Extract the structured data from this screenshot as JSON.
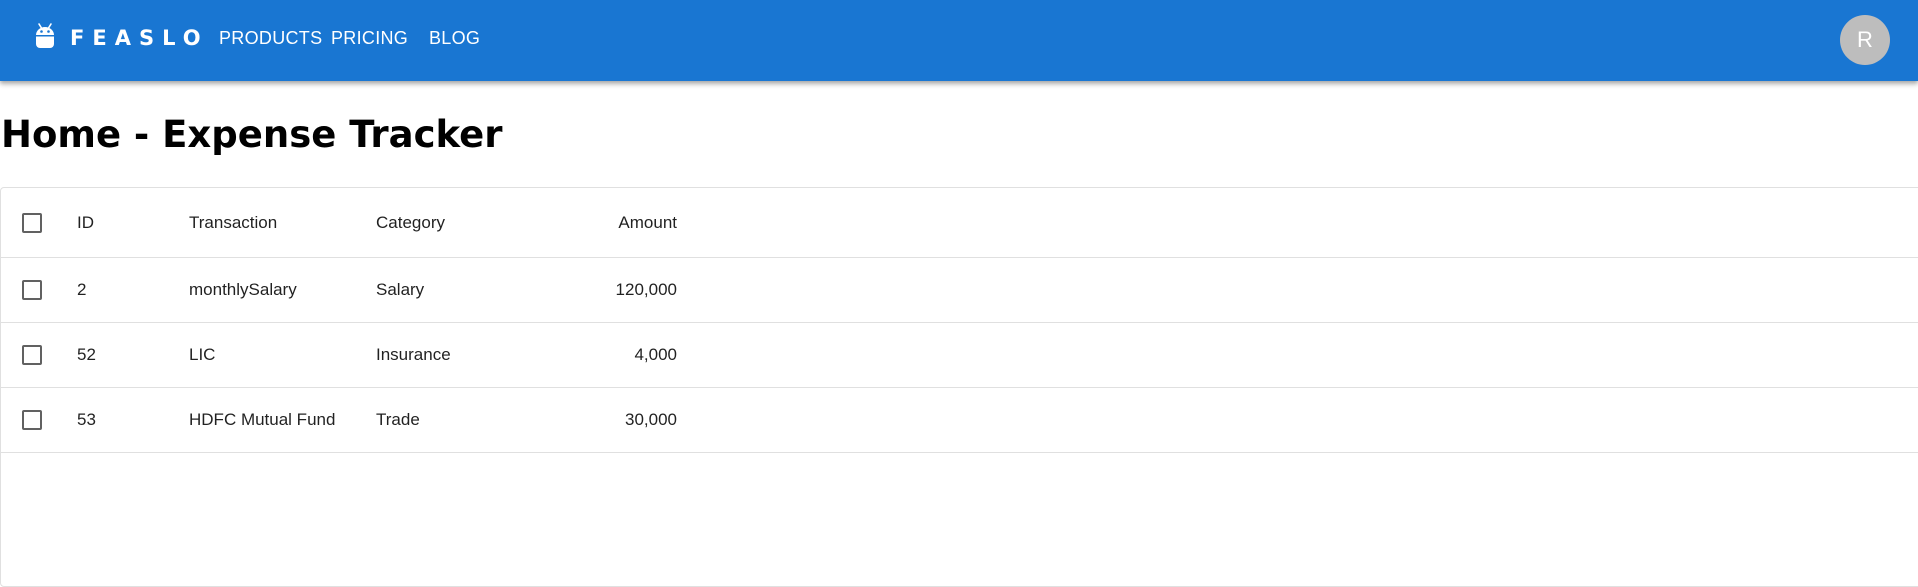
{
  "appbar": {
    "brand": "FEASLO",
    "nav": [
      "PRODUCTS",
      "PRICING",
      "BLOG"
    ],
    "avatar_letter": "R",
    "color": "#1976d2"
  },
  "page": {
    "title": "Home - Expense Tracker"
  },
  "table": {
    "columns": [
      "ID",
      "Transaction",
      "Category",
      "Amount"
    ],
    "rows": [
      [
        "2",
        "monthlySalary",
        "Salary",
        "120,000"
      ],
      [
        "52",
        "LIC",
        "Insurance",
        "4,000"
      ],
      [
        "53",
        "HDFC Mutual Fund",
        "Trade",
        "30,000"
      ]
    ]
  }
}
